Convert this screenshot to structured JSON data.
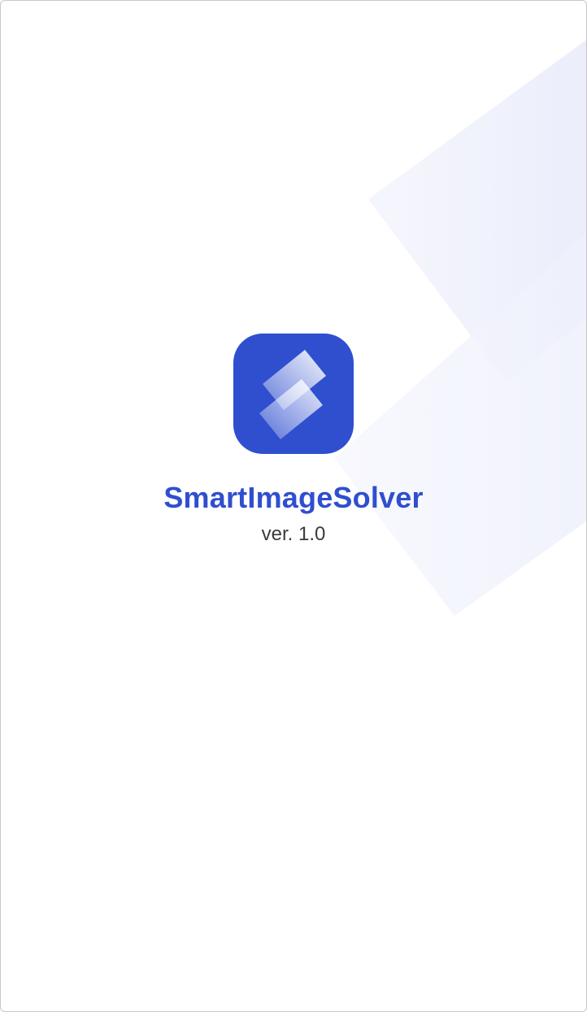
{
  "splash": {
    "app_name": "SmartImageSolver",
    "version": "ver. 1.0",
    "logo_icon": "stacked-layers-logo"
  },
  "colors": {
    "brand": "#2f4fcf",
    "background": "#ffffff",
    "version_text": "#3b3b3b",
    "decor_tint": "#eef0fb"
  }
}
